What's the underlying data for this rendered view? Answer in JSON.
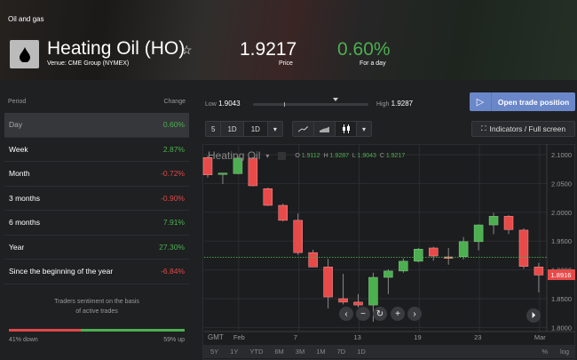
{
  "header": {
    "category": "Oil and gas",
    "title": "Heating Oil (HO)",
    "venue": "Venue: CME Group (NYMEX)",
    "price": "1.9217",
    "price_label": "Price",
    "change": "0.60%",
    "change_label": "For a day",
    "icon": "oil-drop-icon"
  },
  "periods": {
    "col_period": "Period",
    "col_change": "Change",
    "rows": [
      {
        "label": "Day",
        "value": "0.60%",
        "dir": "pos"
      },
      {
        "label": "Week",
        "value": "2.87%",
        "dir": "pos"
      },
      {
        "label": "Month",
        "value": "-0.72%",
        "dir": "neg"
      },
      {
        "label": "3 months",
        "value": "-0.90%",
        "dir": "neg"
      },
      {
        "label": "6 months",
        "value": "7.91%",
        "dir": "pos"
      },
      {
        "label": "Year",
        "value": "27.30%",
        "dir": "pos"
      },
      {
        "label": "Since the beginning of the year",
        "value": "-6.84%",
        "dir": "neg"
      }
    ]
  },
  "sentiment": {
    "text1": "Traders sentiment on the basis",
    "text2": "of active trades",
    "down": "41% down",
    "up": "59% up",
    "down_pct": 41
  },
  "range": {
    "low_label": "Low",
    "low": "1.9043",
    "high_label": "High",
    "high": "1.9287"
  },
  "open_trade": "Open trade position",
  "toolbar": {
    "b1": "5",
    "b2": "1D",
    "b3": "1D",
    "indicators": "Indicators / Full screen"
  },
  "chart_data": {
    "type": "candlestick",
    "title": "Heating Oil",
    "ohlc": {
      "o_label": "O",
      "o": "1.9112",
      "h_label": "H",
      "h": "1.9287",
      "l_label": "L",
      "l": "1.9043",
      "c_label": "C",
      "c": "1.9217"
    },
    "last_price": "1.8916",
    "close_line": 1.9217,
    "ylim": [
      1.78,
      2.118
    ],
    "yticks": [
      "2.1000",
      "2.0500",
      "2.0000",
      "1.9500",
      "1.9000",
      "1.8500",
      "1.8000"
    ],
    "xticks": [
      {
        "label": "Feb",
        "i": 2
      },
      {
        "label": "7",
        "i": 6
      },
      {
        "label": "13",
        "i": 10
      },
      {
        "label": "19",
        "i": 14
      },
      {
        "label": "23",
        "i": 18
      },
      {
        "label": "Mar",
        "i": 22
      }
    ],
    "tz": "GMT",
    "candles": [
      [
        2.095,
        2.098,
        2.06,
        2.065
      ],
      [
        2.066,
        2.068,
        2.049,
        2.068
      ],
      [
        2.067,
        2.097,
        2.066,
        2.094
      ],
      [
        2.094,
        2.096,
        2.045,
        2.046
      ],
      [
        2.041,
        2.043,
        2.011,
        2.012
      ],
      [
        2.012,
        2.015,
        1.984,
        1.986
      ],
      [
        1.986,
        1.998,
        1.926,
        1.93
      ],
      [
        1.93,
        1.935,
        1.905,
        1.905
      ],
      [
        1.905,
        1.919,
        1.833,
        1.853
      ],
      [
        1.85,
        1.893,
        1.84,
        1.844
      ],
      [
        1.844,
        1.858,
        1.835,
        1.839
      ],
      [
        1.839,
        1.895,
        1.81,
        1.887
      ],
      [
        1.887,
        1.901,
        1.858,
        1.898
      ],
      [
        1.898,
        1.92,
        1.895,
        1.915
      ],
      [
        1.915,
        1.938,
        1.913,
        1.936
      ],
      [
        1.938,
        1.94,
        1.916,
        1.924
      ],
      [
        1.9225,
        1.938,
        1.909,
        1.922
      ],
      [
        1.923,
        1.957,
        1.918,
        1.949
      ],
      [
        1.949,
        1.979,
        1.934,
        1.978
      ],
      [
        1.978,
        1.999,
        1.962,
        1.993
      ],
      [
        1.993,
        1.995,
        1.962,
        1.97
      ],
      [
        1.969,
        1.972,
        1.902,
        1.906
      ],
      [
        1.905,
        1.912,
        1.861,
        1.891
      ]
    ],
    "ranges": [
      "5Y",
      "1Y",
      "YTD",
      "6M",
      "3M",
      "1M",
      "7D",
      "1D"
    ],
    "pct": "%",
    "log": "log"
  },
  "colors": {
    "up": "#4caf50",
    "down": "#e84a4a",
    "accent": "#6a87c9"
  }
}
